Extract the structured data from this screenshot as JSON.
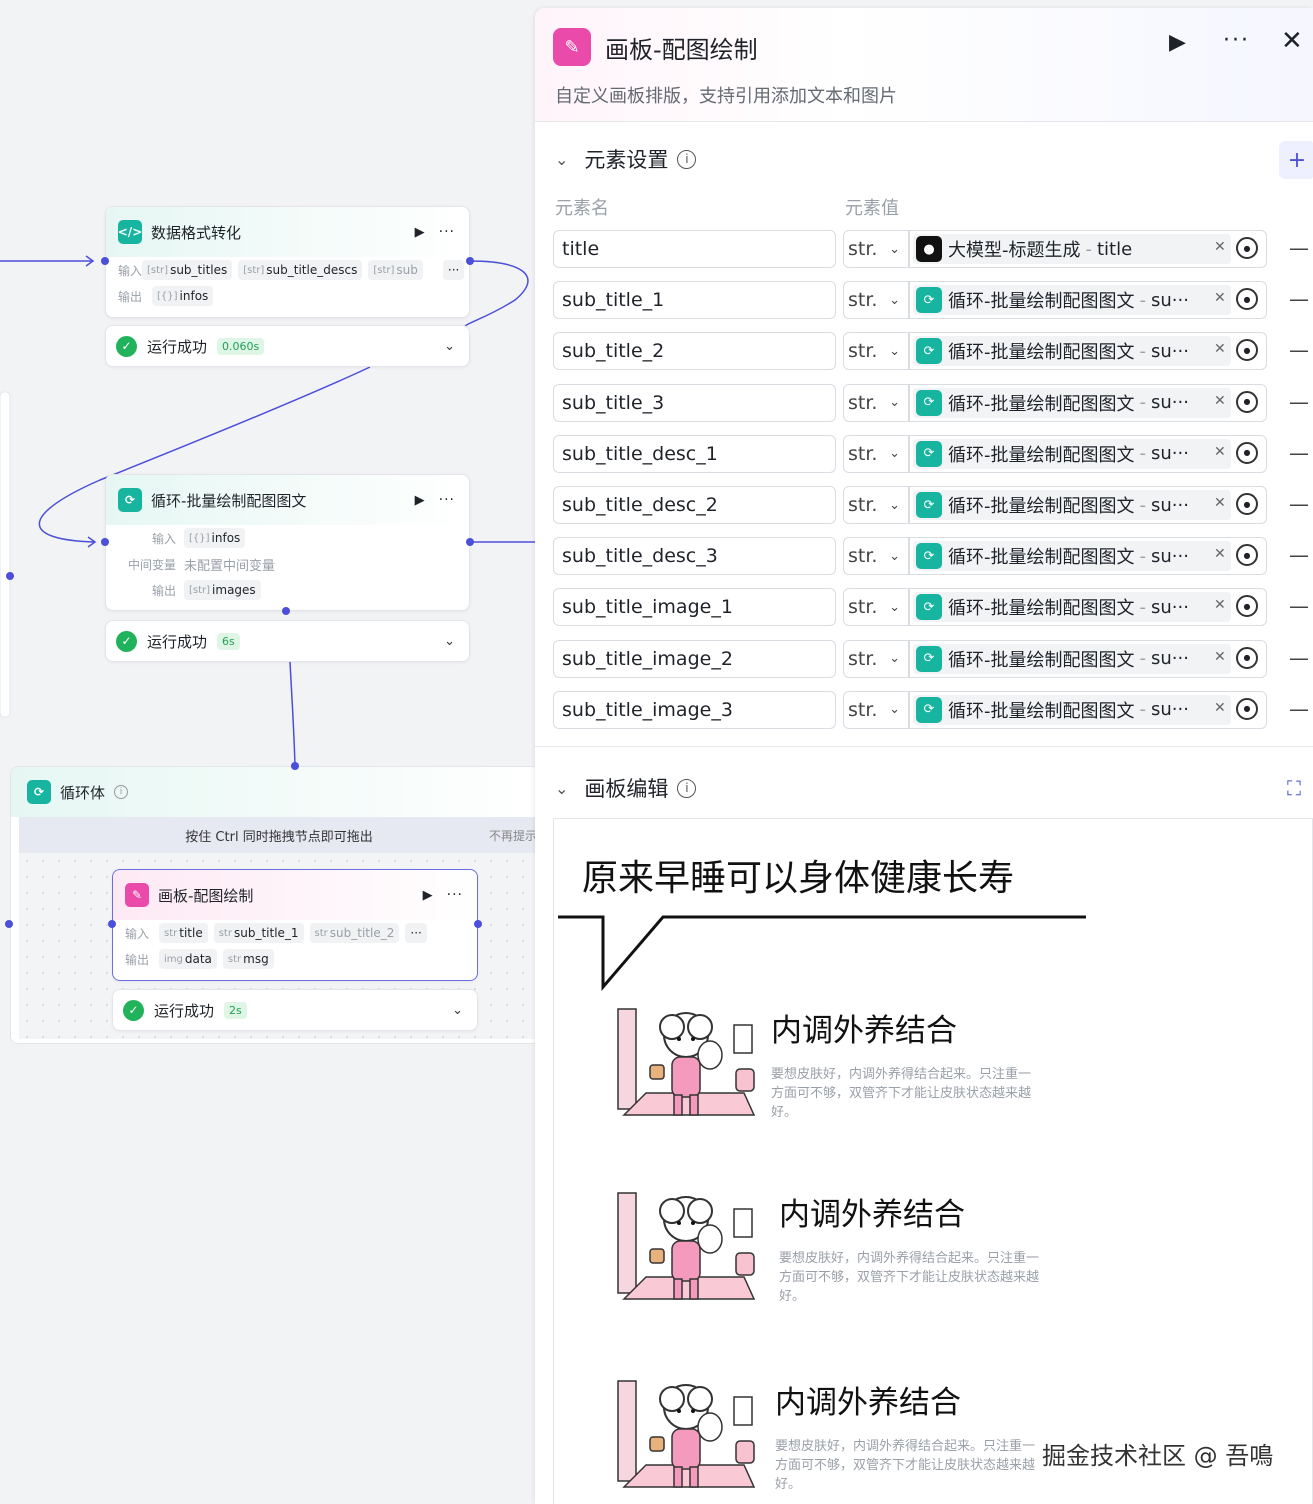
{
  "canvas": {
    "node1": {
      "title": "数据格式转化",
      "in_label": "输入",
      "out_label": "输出",
      "inputs": [
        "sub_titles",
        "sub_title_descs",
        "sub"
      ],
      "input_types": [
        "[str]",
        "[str]",
        "[str]"
      ],
      "outputs": [
        "infos"
      ],
      "output_types": [
        "[{}]"
      ],
      "status": "运行成功",
      "time": "0.060s"
    },
    "node2": {
      "title": "循环-批量绘制配图图文",
      "in_label": "输入",
      "mid_label": "中间变量",
      "out_label": "输出",
      "input": "infos",
      "input_type": "[{}]",
      "mid_value": "未配置中间变量",
      "output": "images",
      "output_type": "[str]",
      "status": "运行成功",
      "time": "6s"
    },
    "loop": {
      "title": "循环体",
      "hint": "按住 Ctrl 同时拖拽节点即可拖出",
      "hint_right": "不再提示"
    },
    "node3": {
      "title": "画板-配图绘制",
      "in_label": "输入",
      "out_label": "输出",
      "inputs": [
        "title",
        "sub_title_1",
        "sub_title_2"
      ],
      "input_types": [
        "str",
        "str",
        "str"
      ],
      "outputs": [
        "data",
        "msg"
      ],
      "output_types": [
        "img",
        "str"
      ],
      "status": "运行成功",
      "time": "2s"
    },
    "more": "···"
  },
  "panel": {
    "title": "画板-配图绘制",
    "subtitle": "自定义画板排版，支持引用添加文本和图片",
    "section_elements": "元素设置",
    "col_name": "元素名",
    "col_value": "元素值",
    "elements": [
      {
        "name": "title",
        "type": "str.",
        "source": "大模型-标题生成",
        "field": "title",
        "icon": "llm"
      },
      {
        "name": "sub_title_1",
        "type": "str.",
        "source": "循环-批量绘制配图图文",
        "field": "su···",
        "icon": "loop"
      },
      {
        "name": "sub_title_2",
        "type": "str.",
        "source": "循环-批量绘制配图图文",
        "field": "su···",
        "icon": "loop"
      },
      {
        "name": "sub_title_3",
        "type": "str.",
        "source": "循环-批量绘制配图图文",
        "field": "su···",
        "icon": "loop"
      },
      {
        "name": "sub_title_desc_1",
        "type": "str.",
        "source": "循环-批量绘制配图图文",
        "field": "su···",
        "icon": "loop"
      },
      {
        "name": "sub_title_desc_2",
        "type": "str.",
        "source": "循环-批量绘制配图图文",
        "field": "su···",
        "icon": "loop"
      },
      {
        "name": "sub_title_desc_3",
        "type": "str.",
        "source": "循环-批量绘制配图图文",
        "field": "su···",
        "icon": "loop"
      },
      {
        "name": "sub_title_image_1",
        "type": "str.",
        "source": "循环-批量绘制配图图文",
        "field": "su···",
        "icon": "loop"
      },
      {
        "name": "sub_title_image_2",
        "type": "str.",
        "source": "循环-批量绘制配图图文",
        "field": "su···",
        "icon": "loop"
      },
      {
        "name": "sub_title_image_3",
        "type": "str.",
        "source": "循环-批量绘制配图图文",
        "field": "su···",
        "icon": "loop"
      }
    ],
    "section_canvas": "画板编辑",
    "canvas_title": "原来早睡可以身体健康长寿",
    "items": [
      {
        "heading": "内调外养结合",
        "desc": "要想皮肤好，内调外养得结合起来。只注重一方面可不够，双管齐下才能让皮肤状态越来越好。"
      },
      {
        "heading": "内调外养结合",
        "desc": "要想皮肤好，内调外养得结合起来。只注重一方面可不够，双管齐下才能让皮肤状态越来越好。"
      },
      {
        "heading": "内调外养结合",
        "desc": "要想皮肤好，内调外养得结合起来。只注重一方面可不够，双管齐下才能让皮肤状态越来越好。"
      }
    ]
  },
  "watermark": "掘金技术社区 @ 吾鳴",
  "colors": {
    "accent": "#4c4fd8",
    "teal": "#17b5a0",
    "pink": "#ea4aa9",
    "success": "#21b35b"
  }
}
